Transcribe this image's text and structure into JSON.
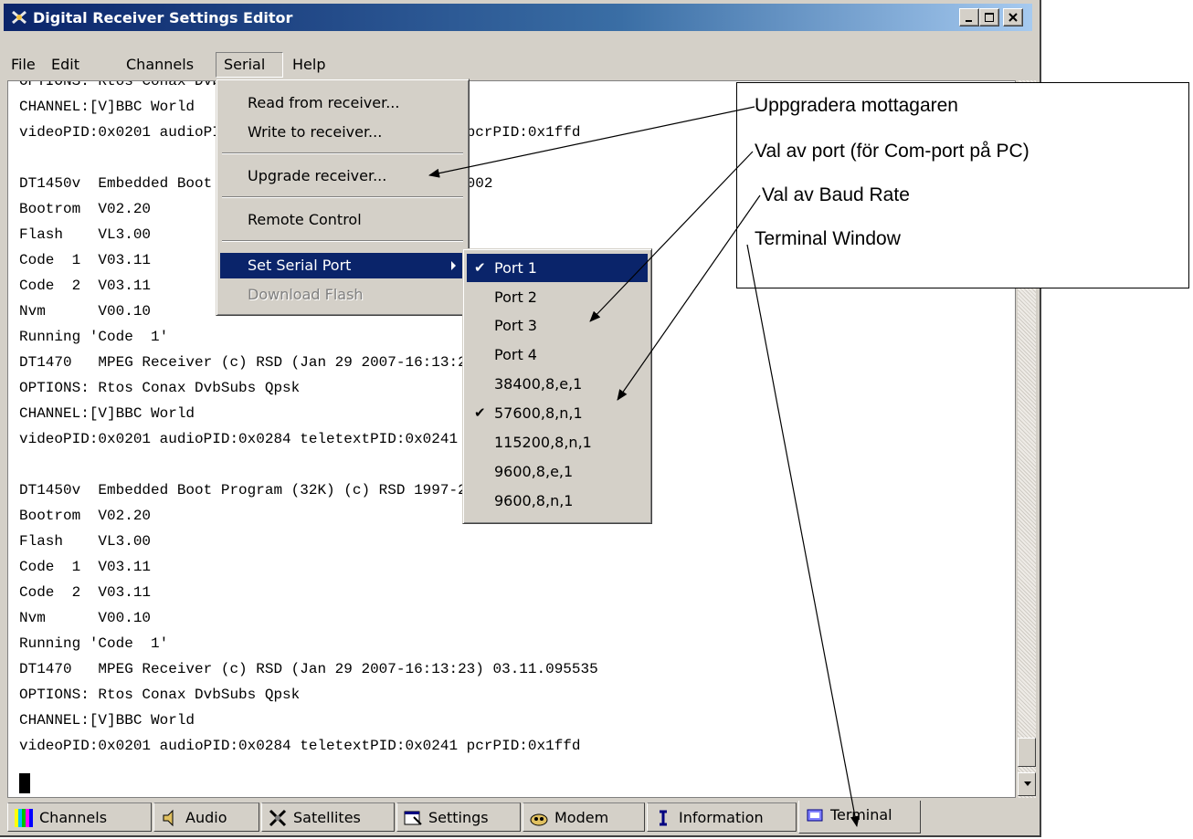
{
  "window": {
    "title": "Digital Receiver Settings Editor",
    "title_gradient_start": "#0a246a",
    "title_gradient_end": "#a6caf0"
  },
  "menubar": {
    "items": [
      "File",
      "Edit",
      "Channels",
      "Serial",
      "Help"
    ],
    "open_item": "Serial"
  },
  "serial_menu": {
    "items": [
      {
        "label": "Read from receiver...",
        "state": "normal"
      },
      {
        "label": "Write to receiver...",
        "state": "normal"
      },
      {
        "label": "Upgrade receiver...",
        "state": "normal"
      },
      {
        "label": "Remote Control",
        "state": "normal"
      },
      {
        "label": "Set Serial Port",
        "state": "highlighted",
        "has_submenu": true
      },
      {
        "label": "Download Flash",
        "state": "disabled"
      }
    ]
  },
  "serial_port_submenu": {
    "items": [
      {
        "label": "Port 1",
        "checked": true,
        "highlighted": true
      },
      {
        "label": "Port 2",
        "checked": false
      },
      {
        "label": "Port 3",
        "checked": false
      },
      {
        "label": "Port 4",
        "checked": false
      },
      {
        "label": "38400,8,e,1",
        "checked": false
      },
      {
        "label": "57600,8,n,1",
        "checked": true
      },
      {
        "label": "115200,8,n,1",
        "checked": false
      },
      {
        "label": "9600,8,e,1",
        "checked": false
      },
      {
        "label": "9600,8,n,1",
        "checked": false
      }
    ]
  },
  "terminal": {
    "lines": [
      "OPTIONS: Rtos Conax DvbSubs Qpsk",
      "CHANNEL:[V]BBC World",
      "videoPID:0x0201 audioPID:0x0284 teletextPID:0x0241 pcrPID:0x1ffd",
      "",
      "DT1450v  Embedded Boot Program (32K) (c) RSD 1997-2002",
      "Bootrom  V02.20",
      "Flash    VL3.00",
      "Code  1  V03.11",
      "Code  2  V03.11",
      "Nvm      V00.10",
      "Running 'Code  1'",
      "DT1470   MPEG Receiver (c) RSD (Jan 29 2007-16:13:23) 03.11.095535",
      "OPTIONS: Rtos Conax DvbSubs Qpsk",
      "CHANNEL:[V]BBC World",
      "videoPID:0x0201 audioPID:0x0284 teletextPID:0x0241 pcrPID:0x1ffd",
      "",
      "DT1450v  Embedded Boot Program (32K) (c) RSD 1997-2002",
      "Bootrom  V02.20",
      "Flash    VL3.00",
      "Code  1  V03.11",
      "Code  2  V03.11",
      "Nvm      V00.10",
      "Running 'Code  1'",
      "DT1470   MPEG Receiver (c) RSD (Jan 29 2007-16:13:23) 03.11.095535",
      "OPTIONS: Rtos Conax DvbSubs Qpsk",
      "CHANNEL:[V]BBC World",
      "videoPID:0x0201 audioPID:0x0284 teletextPID:0x0241 pcrPID:0x1ffd"
    ]
  },
  "tabs": [
    {
      "label": "Channels",
      "icon": "tv-color-bars-icon"
    },
    {
      "label": "Audio",
      "icon": "speaker-icon"
    },
    {
      "label": "Satellites",
      "icon": "satellite-icon"
    },
    {
      "label": "Settings",
      "icon": "settings-window-icon"
    },
    {
      "label": "Modem",
      "icon": "modem-icon"
    },
    {
      "label": "Information",
      "icon": "info-i-icon"
    },
    {
      "label": "Terminal",
      "icon": "terminal-icon",
      "active": true
    }
  ],
  "annotations": [
    "Uppgradera mottagaren",
    "Val av port (för Com-port på PC)",
    "Val av Baud Rate",
    "Terminal Window"
  ],
  "colors": {
    "face": "#d4d0c8",
    "highlight": "#0a246a",
    "disabled_text": "#808080",
    "terminal_bg": "#ffffff"
  }
}
